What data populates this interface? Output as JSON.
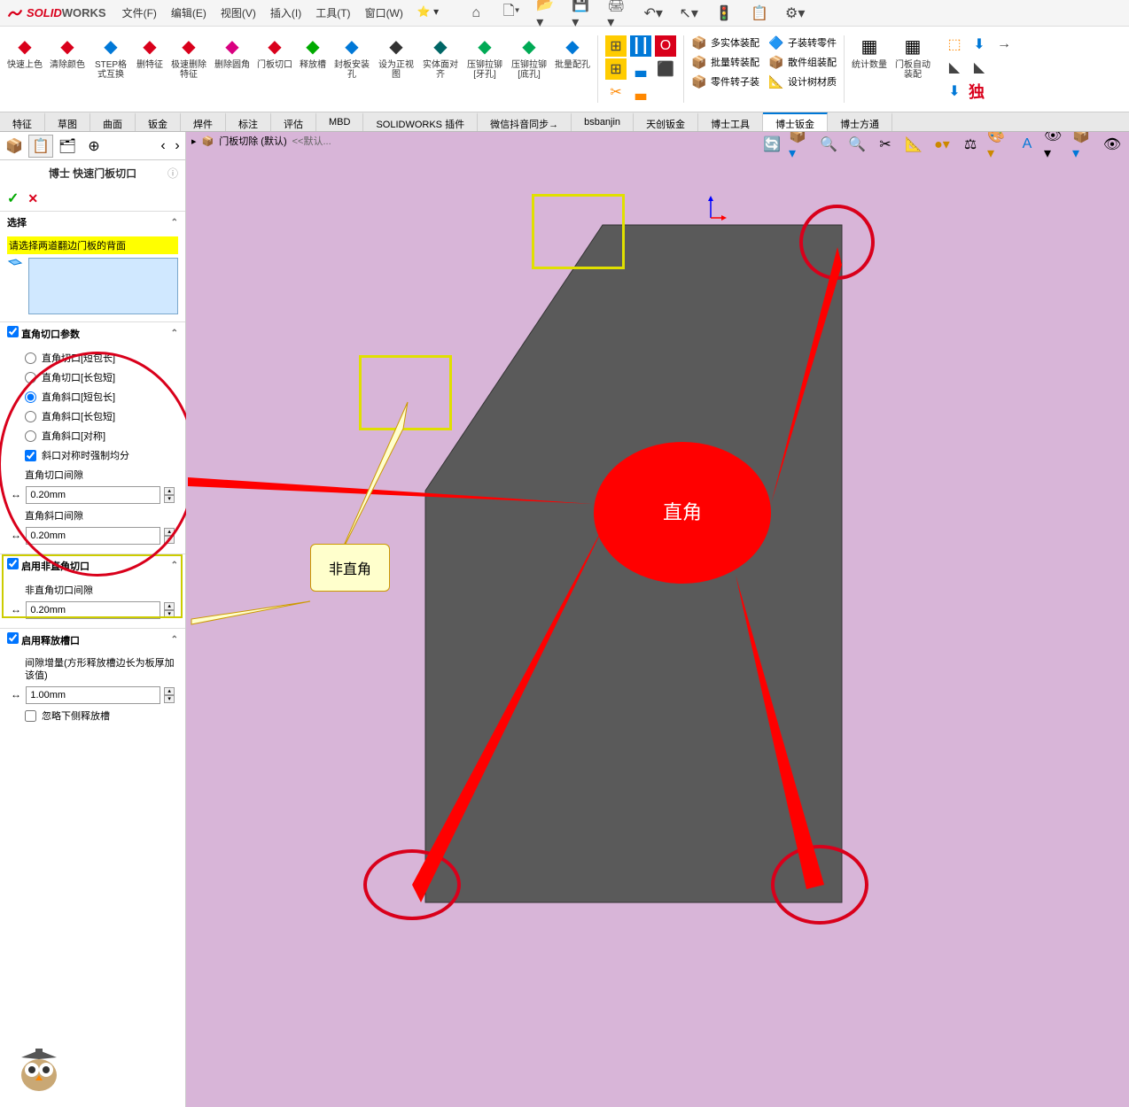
{
  "app": {
    "name1": "SOLID",
    "name2": "WORKS"
  },
  "menu": {
    "file": "文件(F)",
    "edit": "编辑(E)",
    "view": "视图(V)",
    "insert": "插入(I)",
    "tools": "工具(T)",
    "window": "窗口(W)"
  },
  "ribbon": {
    "items": [
      {
        "label": "快速上色",
        "color": "#d9001b"
      },
      {
        "label": "清除颜色",
        "color": "#d9001b"
      },
      {
        "label": "STEP格式互换",
        "color": "#0078d7"
      },
      {
        "label": "删特征",
        "color": "#d9001b"
      },
      {
        "label": "极速删除特征",
        "color": "#d9001b"
      },
      {
        "label": "删除圆角",
        "color": "#d90080"
      },
      {
        "label": "门板切口",
        "color": "#d9001b"
      },
      {
        "label": "释放槽",
        "color": "#00aa00"
      },
      {
        "label": "封板安装孔",
        "color": "#0078d7"
      },
      {
        "label": "设为正视图",
        "color": "#333"
      },
      {
        "label": "实体面对齐",
        "color": "#006666"
      },
      {
        "label": "压铆拉铆[牙孔]",
        "color": "#00aa55"
      },
      {
        "label": "压铆拉铆[底孔]",
        "color": "#00aa55"
      },
      {
        "label": "批量配孔",
        "color": "#0078d7"
      }
    ],
    "mid_grid": [
      "🟨",
      "🟥",
      "🟨",
      "🟦",
      "⬛"
    ],
    "plugins1": [
      {
        "icon": "📦",
        "label": "多实体装配",
        "c": "#cc8800"
      },
      {
        "icon": "📦",
        "label": "批量转装配",
        "c": "#cc0000"
      },
      {
        "icon": "📦",
        "label": "零件转子装",
        "c": "#00aa00"
      }
    ],
    "plugins2": [
      {
        "icon": "🔷",
        "label": "子装转零件",
        "c": "#0078d7"
      },
      {
        "icon": "📦",
        "label": "散件组装配",
        "c": "#cc8800"
      },
      {
        "icon": "📐",
        "label": "设计树材质",
        "c": "#333"
      }
    ],
    "right": [
      {
        "label": "统计数量"
      },
      {
        "label": "门板自动装配"
      }
    ],
    "du": "独"
  },
  "tabs": [
    "特征",
    "草图",
    "曲面",
    "钣金",
    "焊件",
    "标注",
    "评估",
    "MBD",
    "SOLIDWORKS 插件",
    "微信抖音同步→",
    "bsbanjin",
    "天创钣金",
    "博士工具",
    "博士钣金",
    "博士方通"
  ],
  "active_tab": 13,
  "pm": {
    "title": "博士 快速门板切口",
    "select_head": "选择",
    "select_msg": "请选择两道翻边门板的背面",
    "sec1_head": "直角切口参数",
    "radios": [
      "直角切口[短包长]",
      "直角切口[长包短]",
      "直角斜口[短包长]",
      "直角斜口[长包短]",
      "直角斜口[对称]"
    ],
    "radio_sel": 2,
    "chk_sym": "斜口对称时强制均分",
    "lbl_gap1": "直角切口间隙",
    "val_gap1": "0.20mm",
    "lbl_gap2": "直角斜口间隙",
    "val_gap2": "0.20mm",
    "sec2_head": "启用非直角切口",
    "lbl_gap3": "非直角切口间隙",
    "val_gap3": "0.20mm",
    "sec3_head": "启用释放槽口",
    "lbl_inc": "间隙增量(方形释放槽边长为板厚加该值)",
    "val_inc": "1.00mm",
    "chk_ignore": "忽略下侧释放槽"
  },
  "breadcrumb": {
    "item": "门板切除 (默认)",
    "suffix": "<<默认..."
  },
  "callouts": {
    "nonright": "非直角",
    "right": "直角"
  }
}
